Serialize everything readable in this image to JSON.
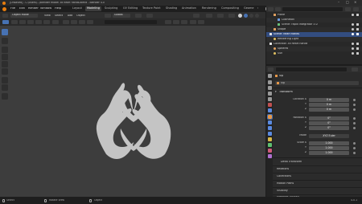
{
  "title_bar": {
    "title": "[Unsaved] - C:\\Users\\...\\blender model 3d heart hands.blend - Blender 4.0"
  },
  "menu": {
    "items": [
      "File",
      "Edit",
      "Render",
      "Window",
      "Help"
    ]
  },
  "workspaces": [
    "Layout",
    "Modeling",
    "Sculpting",
    "UV Editing",
    "Texture Paint",
    "Shading",
    "Animation",
    "Rendering",
    "Compositing",
    "Geome"
  ],
  "workspace_active": "Modeling",
  "scene": {
    "scene_label": "Scene",
    "view_layer_label": "ViewLayer"
  },
  "viewport_header": {
    "mode": "Object Mode",
    "menus": [
      "View",
      "Select",
      "Add",
      "Object"
    ],
    "orientation": "Global",
    "search_placeholder": ""
  },
  "outliner": {
    "rows": [
      {
        "label": "Plane",
        "indent": 1,
        "sel": false
      },
      {
        "label": "ClothMod",
        "indent": 2,
        "sel": false
      },
      {
        "label": "Scene: rapid Integrator 3.0",
        "indent": 2,
        "sel": false
      },
      {
        "label": "Shape",
        "indent": 1,
        "sel": false
      },
      {
        "label": "Scene: heart hands",
        "indent": 0,
        "sel": true
      },
      {
        "label": "Rendering Light",
        "indent": 1,
        "sel": false
      },
      {
        "label": "Collection 3d heart hands",
        "indent": 0,
        "sel": false
      },
      {
        "label": "Spheres",
        "indent": 1,
        "sel": false
      },
      {
        "label": "Sun",
        "indent": 1,
        "sel": false
      }
    ]
  },
  "properties": {
    "object_name": "Vip",
    "object_field": "Vip",
    "transform": {
      "title": "Transform",
      "location_label": "Location X",
      "location": [
        "0 m",
        "0 m",
        "0 m"
      ],
      "rotation_label": "Rotation X",
      "rotation": [
        "0°",
        "0°",
        "0°"
      ],
      "mode_label": "Mode",
      "mode": "XYZ Euler",
      "scale_label": "Scale X",
      "scale": [
        "1.000",
        "1.000",
        "1.000"
      ],
      "y": "Y",
      "z": "Z"
    },
    "collapsed_panels": [
      "Delta Transform",
      "Relations",
      "Collections",
      "Motion Paths",
      "Visibility",
      "Viewport Display"
    ]
  },
  "status_bar": {
    "select": "Select",
    "rotate": "Rotate View",
    "object": "Object",
    "version": "4.0.1"
  },
  "colors": {
    "accent": "#4772b3",
    "hands": "#c4c4c4",
    "viewport": "#3d3d3d"
  }
}
